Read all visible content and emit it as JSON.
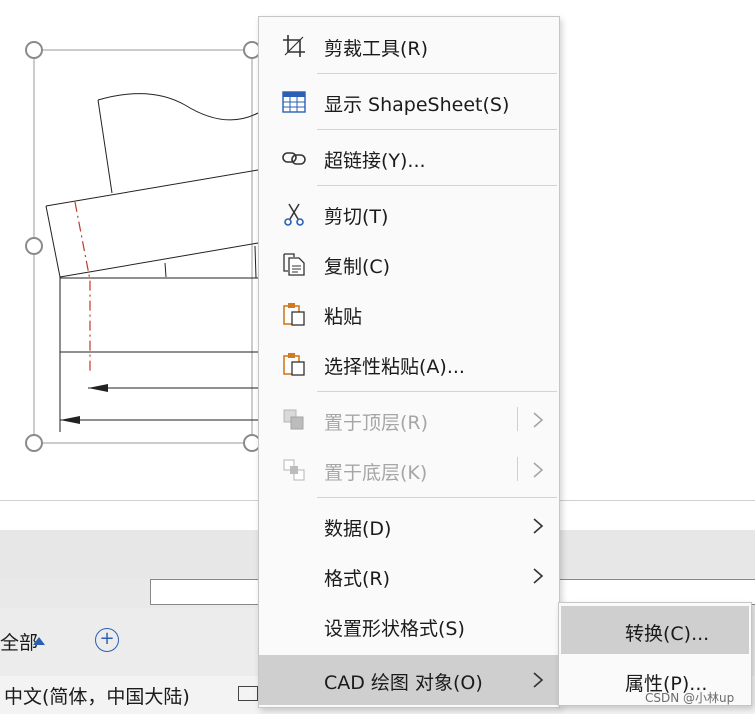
{
  "context_menu": {
    "items": [
      {
        "label": "剪裁工具(R)",
        "icon": "crop-icon",
        "enabled": true
      },
      {
        "label": "显示 ShapeSheet(S)",
        "icon": "shapesheet-icon",
        "enabled": true
      },
      {
        "label": "超链接(Y)...",
        "icon": "hyperlink-icon",
        "enabled": true
      },
      {
        "label": "剪切(T)",
        "icon": "scissors-icon",
        "enabled": true
      },
      {
        "label": "复制(C)",
        "icon": "copy-icon",
        "enabled": true
      },
      {
        "label": "粘贴",
        "icon": "paste-icon",
        "enabled": true
      },
      {
        "label": "选择性粘贴(A)...",
        "icon": "paste-special-icon",
        "enabled": true
      },
      {
        "label": "置于顶层(R)",
        "icon": "bring-to-front-icon",
        "enabled": false
      },
      {
        "label": "置于底层(K)",
        "icon": "send-to-back-icon",
        "enabled": false
      },
      {
        "label": "数据(D)",
        "enabled": true
      },
      {
        "label": "格式(R)",
        "enabled": true
      },
      {
        "label": "设置形状格式(S)",
        "enabled": true
      },
      {
        "label": "CAD 绘图 对象(O)",
        "enabled": true,
        "highlighted": true
      }
    ]
  },
  "submenu": {
    "items": [
      {
        "label": "转换(C)...",
        "highlighted": true
      },
      {
        "label": "属性(P)..."
      }
    ]
  },
  "page_tabs": {
    "all_label": "全部",
    "add_icon": "plus-circle-icon"
  },
  "status_bar": {
    "language": "中文(简体，中国大陆)"
  },
  "watermark": "CSDN @小林up",
  "colors": {
    "accent": "#2b5fb4",
    "highlight": "#cfcfcf",
    "disabled": "#a6a6a6",
    "dash_red": "#c0392b",
    "paste_orange": "#d47a1e"
  }
}
